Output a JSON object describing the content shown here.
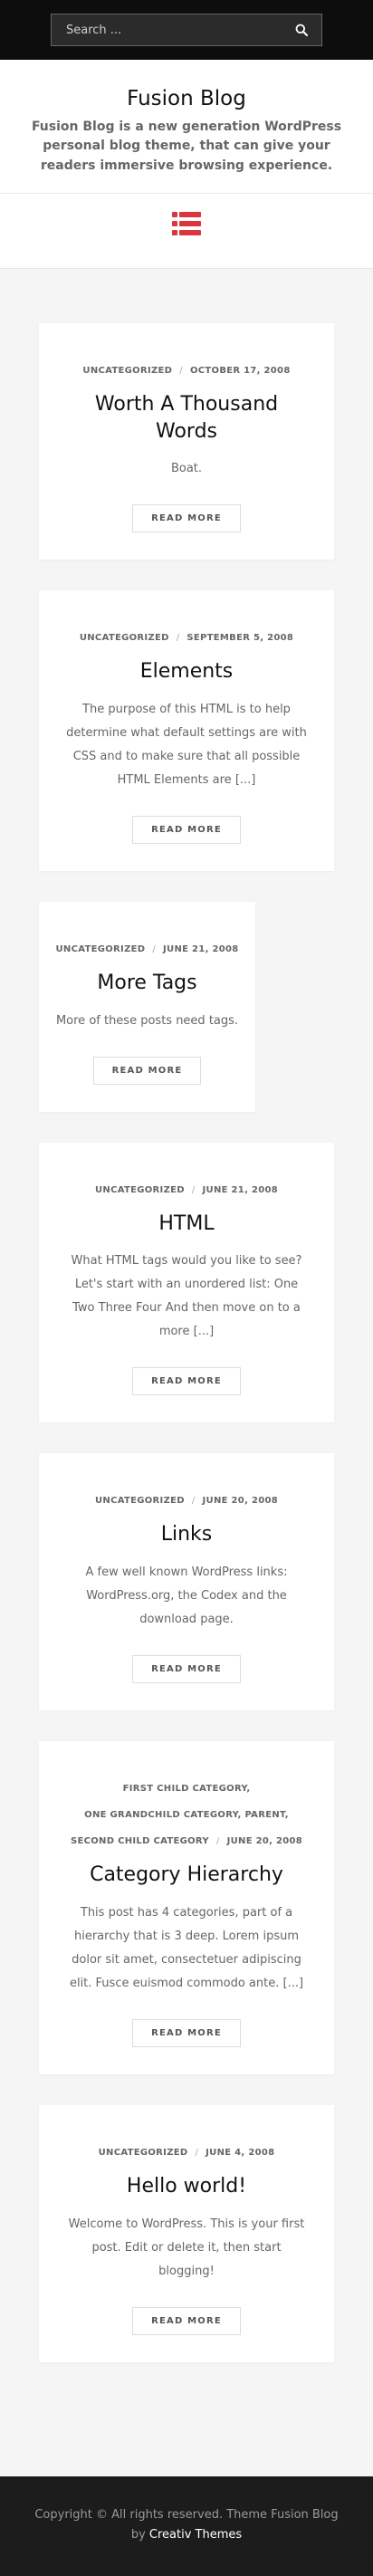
{
  "search": {
    "placeholder": "Search ..."
  },
  "site": {
    "title": "Fusion Blog",
    "description": "Fusion Blog is a new generation WordPress personal blog theme, that can give your readers immersive browsing experience."
  },
  "colors": {
    "accent": "#d9363e",
    "topbar": "#0d0d0d",
    "footer": "#1c1c1c"
  },
  "posts": [
    {
      "meta": [
        [
          "UNCATEGORIZED",
          "OCTOBER 17, 2008"
        ]
      ],
      "title": "Worth A Thousand Words",
      "excerpt": "Boat.",
      "read_more": "READ MORE"
    },
    {
      "meta": [
        [
          "UNCATEGORIZED",
          "SEPTEMBER 5, 2008"
        ]
      ],
      "title": "Elements",
      "excerpt": "The purpose of this HTML is to help determine what default settings are with CSS and to make sure that all possible HTML Elements are [...]",
      "read_more": "READ MORE"
    },
    {
      "meta": [
        [
          "UNCATEGORIZED",
          "JUNE 21, 2008"
        ]
      ],
      "title": "More Tags",
      "excerpt": "More of these posts need tags.",
      "read_more": "READ MORE"
    },
    {
      "meta": [
        [
          "UNCATEGORIZED",
          "JUNE 21, 2008"
        ]
      ],
      "title": "HTML",
      "excerpt": "What HTML tags would you like to see? Let's start with an unordered list: One Two Three Four And then move on to a more [...]",
      "read_more": "READ MORE"
    },
    {
      "meta": [
        [
          "UNCATEGORIZED",
          "JUNE 20, 2008"
        ]
      ],
      "title": "Links",
      "excerpt": "A few well known WordPress links: WordPress.org, the Codex and the download page.",
      "read_more": "READ MORE"
    },
    {
      "meta": [
        [
          "FIRST CHILD CATEGORY,"
        ],
        [
          "ONE GRANDCHILD CATEGORY,",
          "PARENT,"
        ],
        [
          "SECOND CHILD CATEGORY",
          "JUNE 20, 2008"
        ]
      ],
      "title": "Category Hierarchy",
      "excerpt": "This post has 4 categories, part of a hierarchy that is 3 deep. Lorem ipsum dolor sit amet, consectetuer adipiscing elit. Fusce euismod commodo ante. [...]",
      "read_more": "READ MORE"
    },
    {
      "meta": [
        [
          "UNCATEGORIZED",
          "JUNE 4, 2008"
        ]
      ],
      "title": "Hello world!",
      "excerpt": "Welcome to WordPress. This is your first post. Edit or delete it, then start blogging!",
      "read_more": "READ MORE"
    }
  ],
  "footer": {
    "text": "Copyright © All rights reserved. Theme Fusion Blog by",
    "brand": "Creativ Themes"
  }
}
